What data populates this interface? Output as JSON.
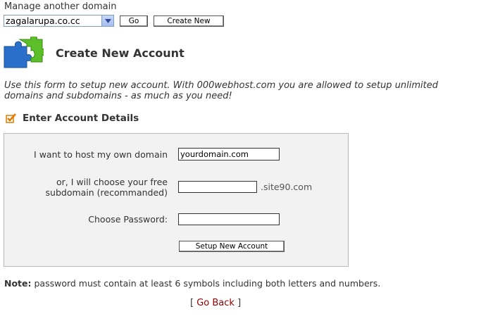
{
  "top": {
    "manage_label": "Manage another domain",
    "selected_domain": "zagalarupa.co.cc",
    "go_label": "Go",
    "create_new_label": "Create New"
  },
  "header": {
    "title": "Create New Account",
    "icon": "puzzle-icon"
  },
  "intro": "Use this form to setup new account. With 000webhost.com you are allowed to setup unlimited domains and subdomains - as much as you need!",
  "section": {
    "title": "Enter Account Details",
    "icon": "check-icon"
  },
  "form": {
    "own_domain_label": "I want to host my own domain",
    "own_domain_value": "yourdomain.com",
    "subdomain_label_line1": "or, I will choose your free",
    "subdomain_label_line2": "subdomain (recommanded)",
    "subdomain_value": "",
    "subdomain_suffix": ".site90.com",
    "password_label": "Choose Password:",
    "password_value": "",
    "submit_label": "Setup New Account"
  },
  "note": {
    "prefix": "Note:",
    "text": " password must contain at least 6 symbols including both letters and numbers."
  },
  "back": {
    "open": "[",
    "label": "Go Back",
    "close": "]"
  }
}
